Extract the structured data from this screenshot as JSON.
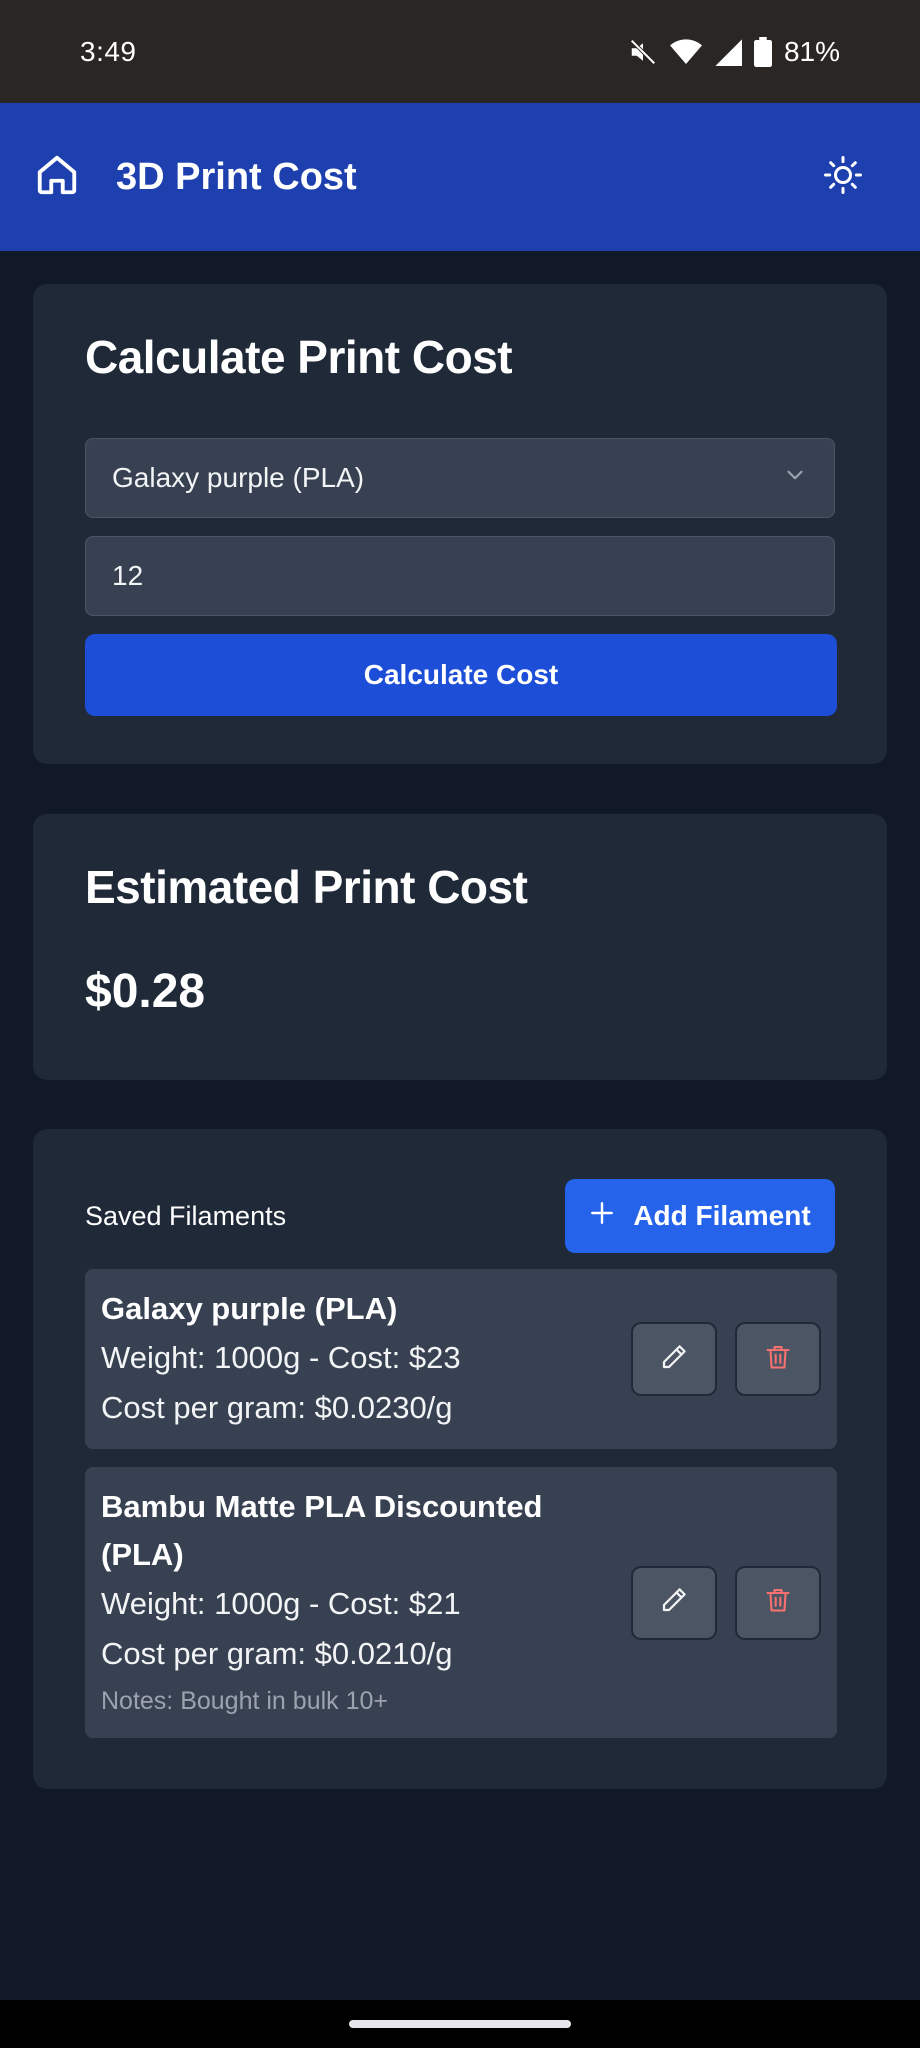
{
  "status_bar": {
    "time": "3:49",
    "battery": "81%",
    "icons": [
      "mute-icon",
      "wifi-icon",
      "signal-icon",
      "battery-icon"
    ]
  },
  "app_bar": {
    "title": "3D Print Cost",
    "home_icon": "home-icon",
    "theme_icon": "sun-icon",
    "background": "#1e40af"
  },
  "calculate_card": {
    "title": "Calculate Print Cost",
    "filament_select_value": "Galaxy purple (PLA)",
    "weight_value": "12",
    "button_label": "Calculate Cost"
  },
  "result_card": {
    "title": "Estimated Print Cost",
    "value": "$0.28"
  },
  "saved_card": {
    "title": "Saved Filaments",
    "add_button_label": "Add Filament",
    "filaments": [
      {
        "name": "Galaxy purple (PLA)",
        "weight_cost": "Weight: 1000g - Cost: $23",
        "cost_per_gram": "Cost per gram: $0.0230/g",
        "notes": ""
      },
      {
        "name": "Bambu Matte PLA Discounted (PLA)",
        "weight_cost": "Weight: 1000g - Cost: $21",
        "cost_per_gram": "Cost per gram: $0.0210/g",
        "notes": "Notes: Bought in bulk 10+"
      }
    ]
  },
  "colors": {
    "page_bg": "#111827",
    "card_bg": "#1f2937",
    "primary": "#1d4ed8",
    "delete_icon": "#f87171"
  }
}
